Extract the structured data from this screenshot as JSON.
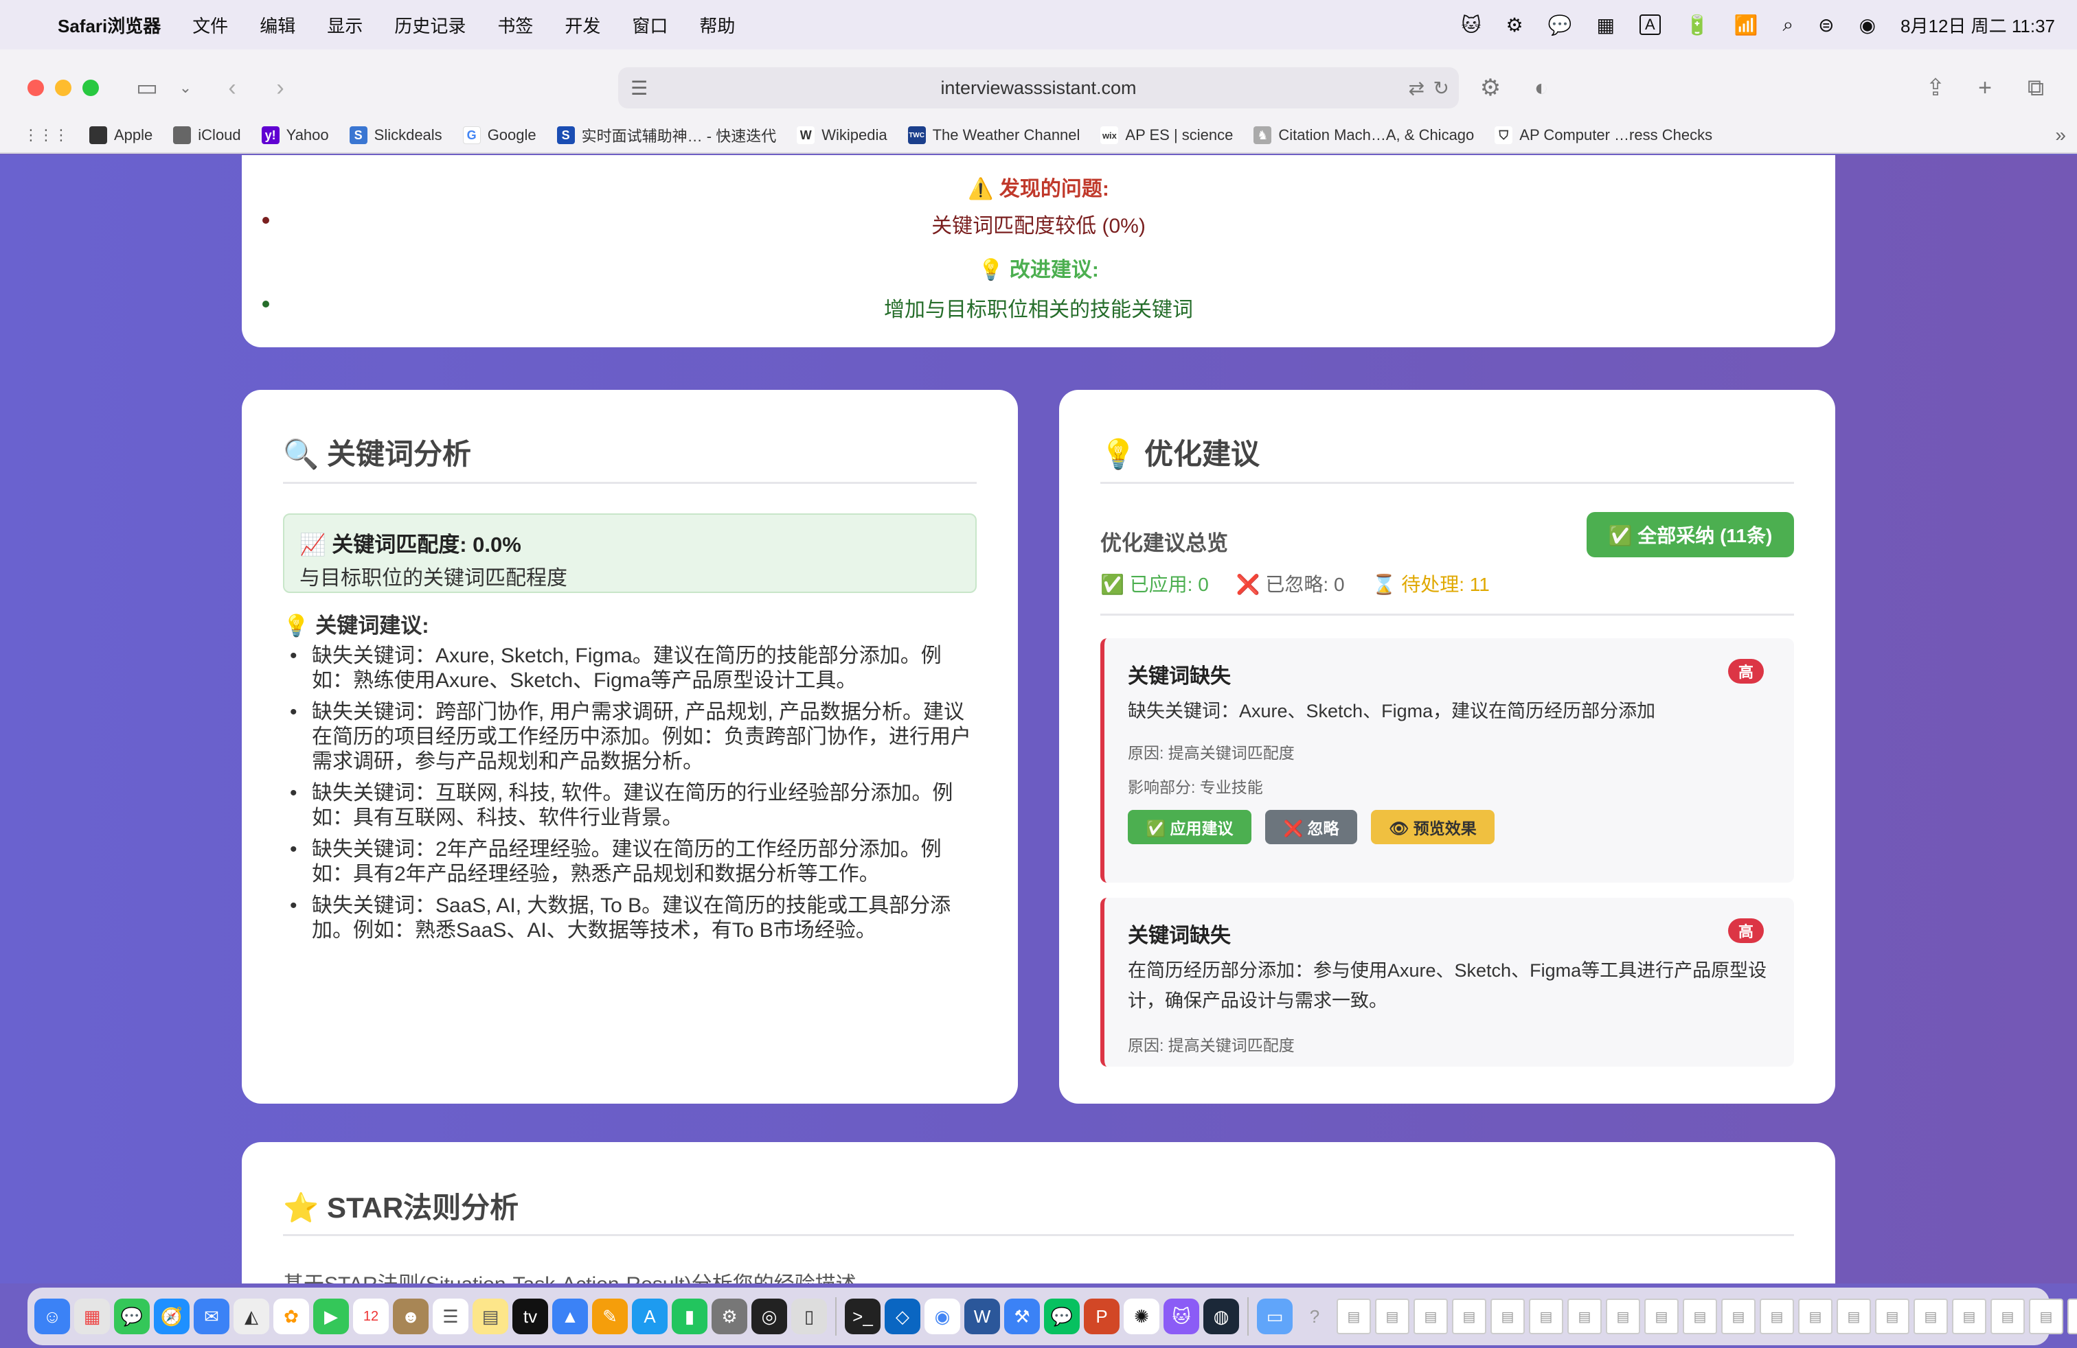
{
  "menubar": {
    "app_name": "Safari浏览器",
    "items": [
      "文件",
      "编辑",
      "显示",
      "历史记录",
      "书签",
      "开发",
      "窗口",
      "帮助"
    ],
    "clock": "8月12日 周二  11:37"
  },
  "browser": {
    "url": "interviewasssistant.com",
    "bookmarks": [
      {
        "label": "Apple",
        "icon": "apple-icon",
        "color": "#333333"
      },
      {
        "label": "iCloud",
        "icon": "apple-icon",
        "color": "#333333"
      },
      {
        "label": "Yahoo",
        "icon": "yahoo-icon",
        "color": "#6001d2"
      },
      {
        "label": "Slickdeals",
        "icon": "slickdeals-icon",
        "color": "#3a76d2"
      },
      {
        "label": "Google",
        "icon": "google-icon",
        "color": "#4285f4"
      },
      {
        "label": "实时面试辅助神… - 快速迭代",
        "icon": "s-icon",
        "color": "#1a4db3"
      },
      {
        "label": "Wikipedia",
        "icon": "wikipedia-icon",
        "color": "#333333"
      },
      {
        "label": "The Weather Channel",
        "icon": "weather-icon",
        "color": "#1b3f8c"
      },
      {
        "label": "AP ES | science",
        "icon": "wix-icon",
        "color": "#333333"
      },
      {
        "label": "Citation Mach…A, & Chicago",
        "icon": "citation-icon",
        "color": "#777777"
      },
      {
        "label": "AP Computer …ress Checks",
        "icon": "shield-icon",
        "color": "#333333"
      }
    ]
  },
  "issues": {
    "problem_title": "⚠️ 发现的问题:",
    "problem_text": "关键词匹配度较低 (0%)",
    "suggest_title": "💡 改进建议:",
    "suggest_text": "增加与目标职位相关的技能关键词"
  },
  "keywords": {
    "title": "🔍 关键词分析",
    "match_label": "📈 关键词匹配度: 0.0%",
    "match_desc": "与目标职位的关键词匹配程度",
    "sub_title": "💡 关键词建议:",
    "items": [
      "缺失关键词：Axure, Sketch, Figma。建议在简历的技能部分添加。例如：熟练使用Axure、Sketch、Figma等产品原型设计工具。",
      "缺失关键词：跨部门协作, 用户需求调研, 产品规划, 产品数据分析。建议在简历的项目经历或工作经历中添加。例如：负责跨部门协作，进行用户需求调研，参与产品规划和产品数据分析。",
      "缺失关键词：互联网, 科技, 软件。建议在简历的行业经验部分添加。例如：具有互联网、科技、软件行业背景。",
      "缺失关键词：2年产品经理经验。建议在简历的工作经历部分添加。例如：具有2年产品经理经验，熟悉产品规划和数据分析等工作。",
      "缺失关键词：SaaS, AI, 大数据, To B。建议在简历的技能或工具部分添加。例如：熟悉SaaS、AI、大数据等技术，有To B市场经验。"
    ]
  },
  "optimization": {
    "title": "💡 优化建议",
    "overview": "优化建议总览",
    "accept_all": "✅ 全部采纳 (11条)",
    "applied": "✅ 已应用: 0",
    "ignored": "❌ 已忽略: 0",
    "pending": "⌛ 待处理: 11",
    "cards": [
      {
        "title": "关键词缺失",
        "badge": "高",
        "desc": "缺失关键词：Axure、Sketch、Figma，建议在简历经历部分添加",
        "reason": "原因: 提高关键词匹配度",
        "section": "影响部分: 专业技能",
        "apply": "✅ 应用建议",
        "ignore": "❌ 忽略",
        "preview": "👁 预览效果"
      },
      {
        "title": "关键词缺失",
        "badge": "高",
        "desc": "在简历经历部分添加：参与使用Axure、Sketch、Figma等工具进行产品原型设计，确保产品设计与需求一致。",
        "reason": "原因: 提高关键词匹配度"
      }
    ]
  },
  "star": {
    "title": "⭐ STAR法则分析",
    "desc": "基于STAR法则(Situation-Task-Action-Result)分析您的经验描述"
  },
  "colors": {
    "accent_green": "#4caf50",
    "danger_red": "#dc3545",
    "warning_yellow": "#f0c040",
    "background_purple": "#6e5fc4"
  }
}
